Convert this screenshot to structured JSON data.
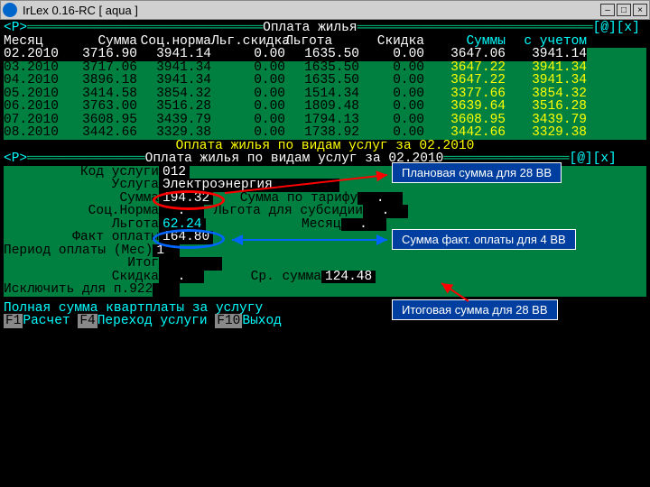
{
  "window": {
    "title": "IrLex 0.16-RC [ aqua ]"
  },
  "panel1": {
    "prefix": "<P>",
    "title": "Оплата жилья",
    "ctrl": "[@][x]",
    "headers": [
      "Месяц",
      "Сумма",
      "Соц.норма",
      "Льг.скидка",
      "Льгота",
      "Скидка",
      "Суммы",
      "с учетом"
    ],
    "rows": [
      {
        "m": "02.2010",
        "s": "3716.90",
        "n": "3941.14",
        "d": "0.00",
        "b": "1635.50",
        "k": "0.00",
        "t": "3647.06",
        "a": "3941.14",
        "sel": true
      },
      {
        "m": "03.2010",
        "s": "3717.06",
        "n": "3941.34",
        "d": "0.00",
        "b": "1635.50",
        "k": "0.00",
        "t": "3647.22",
        "a": "3941.34"
      },
      {
        "m": "04.2010",
        "s": "3896.18",
        "n": "3941.34",
        "d": "0.00",
        "b": "1635.50",
        "k": "0.00",
        "t": "3647.22",
        "a": "3941.34"
      },
      {
        "m": "05.2010",
        "s": "3414.58",
        "n": "3854.32",
        "d": "0.00",
        "b": "1514.34",
        "k": "0.00",
        "t": "3377.66",
        "a": "3854.32"
      },
      {
        "m": "06.2010",
        "s": "3763.00",
        "n": "3516.28",
        "d": "0.00",
        "b": "1809.48",
        "k": "0.00",
        "t": "3639.64",
        "a": "3516.28"
      },
      {
        "m": "07.2010",
        "s": "3608.95",
        "n": "3439.79",
        "d": "0.00",
        "b": "1794.13",
        "k": "0.00",
        "t": "3608.95",
        "a": "3439.79"
      },
      {
        "m": "08.2010",
        "s": "3442.66",
        "n": "3329.38",
        "d": "0.00",
        "b": "1738.92",
        "k": "0.00",
        "t": "3442.66",
        "a": "3329.38"
      }
    ]
  },
  "section_title": "Оплата жилья по видам услуг за 02.2010",
  "panel2": {
    "prefix": "<P>",
    "title": "Оплата жилья по видам услуг за 02.2010",
    "ctrl": "[@][x]",
    "fields": {
      "code_lbl": "Код услуги",
      "code": "012",
      "service_lbl": "Услуга",
      "service": "Электроэнергия",
      "sum_lbl": "Сумма",
      "sum": "194.32",
      "tariff_lbl": "Сумма по тарифу",
      "tariff": ".",
      "norm_lbl": "Соц.Норма",
      "norm": ".",
      "subs_lbl": "Льгота для субсидии",
      "subs": ".",
      "benefit_lbl": "Льгота",
      "benefit": "62.24",
      "month_lbl": "Месяц",
      "month": ".",
      "fact_lbl": "Факт оплаты",
      "fact": "164.80",
      "period_lbl": "Период оплаты (Мес)",
      "period": "1",
      "total_lbl": "Итог",
      "total": "",
      "discount_lbl": "Скидка",
      "discount": ".",
      "avg_lbl": "Ср. сумма",
      "avg": "124.48",
      "excl_lbl": "Исключить для п.922",
      "excl": ""
    }
  },
  "footer": {
    "hint": "Полная сумма квартплаты за услугу",
    "f1": "F1",
    "f1_lbl": "Расчет",
    "f4": "F4",
    "f4_lbl": "Переход услуги",
    "f10": "F10",
    "f10_lbl": "Выход"
  },
  "callouts": {
    "plan": "Плановая сумма для 28 ВВ",
    "fact": "Сумма факт. оплаты  для 4 ВВ",
    "total": "Итоговая сумма для 28 ВВ"
  }
}
